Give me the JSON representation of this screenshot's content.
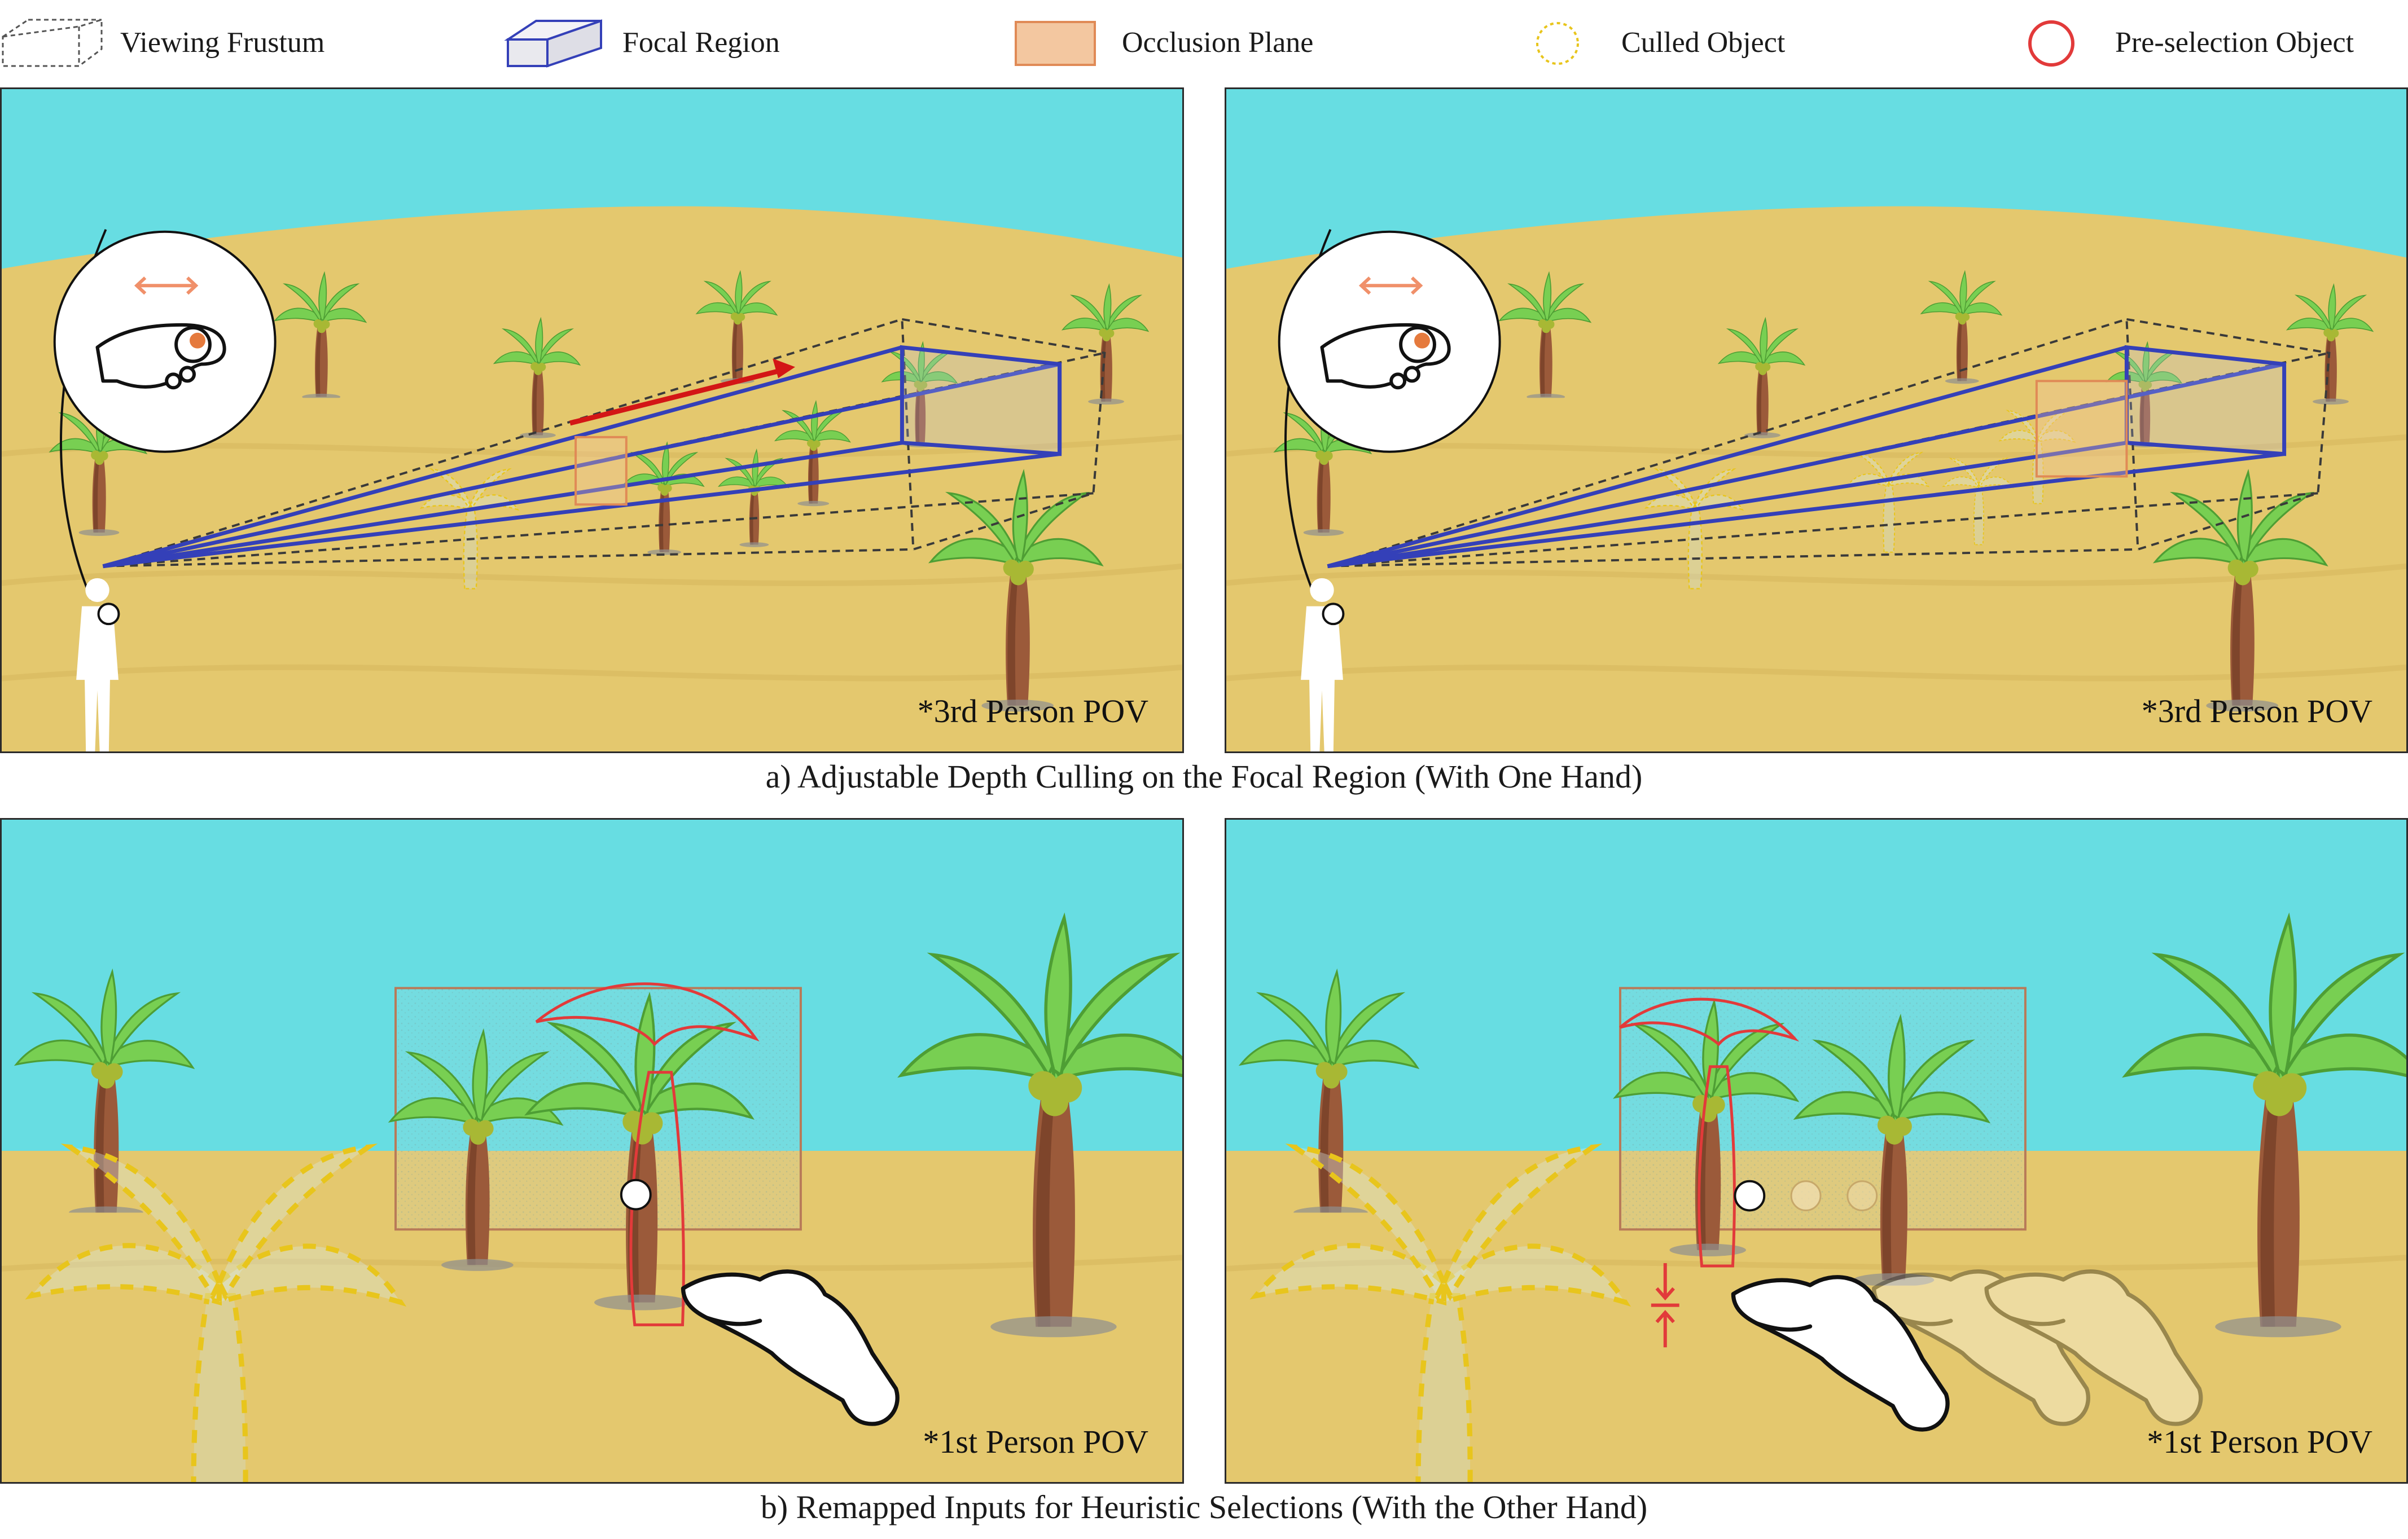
{
  "legend": [
    {
      "label": "Viewing Frustum",
      "icon": "frustum-icon"
    },
    {
      "label": "Focal Region",
      "icon": "focal-region-icon"
    },
    {
      "label": "Occlusion Plane",
      "icon": "occlusion-plane-icon"
    },
    {
      "label": "Culled Object",
      "icon": "culled-object-icon"
    },
    {
      "label": "Pre-selection Object",
      "icon": "preselection-object-icon"
    }
  ],
  "colors": {
    "sky": "#67dde2",
    "sand": "#e4c86e",
    "frustum_line": "#3a3a3a",
    "focal_region": "#3440b8",
    "occlusion_plane": "#e6a06a",
    "culled": "#e8c51c",
    "preselection": "#e23a3a",
    "arrow": "#d31616",
    "palm_leaf": "#78cf52",
    "trunk": "#9b5a3a"
  },
  "panels": {
    "top_left": {
      "pov": "*3rd Person POV"
    },
    "top_right": {
      "pov": "*3rd Person POV"
    },
    "bottom_left": {
      "pov": "*1st Person POV"
    },
    "bottom_right": {
      "pov": "*1st Person POV"
    }
  },
  "captions": {
    "a": "a) Adjustable Depth Culling on the Focal Region (With One Hand)",
    "b": "b)  Remapped Inputs for Heuristic Selections (With the Other Hand)"
  }
}
